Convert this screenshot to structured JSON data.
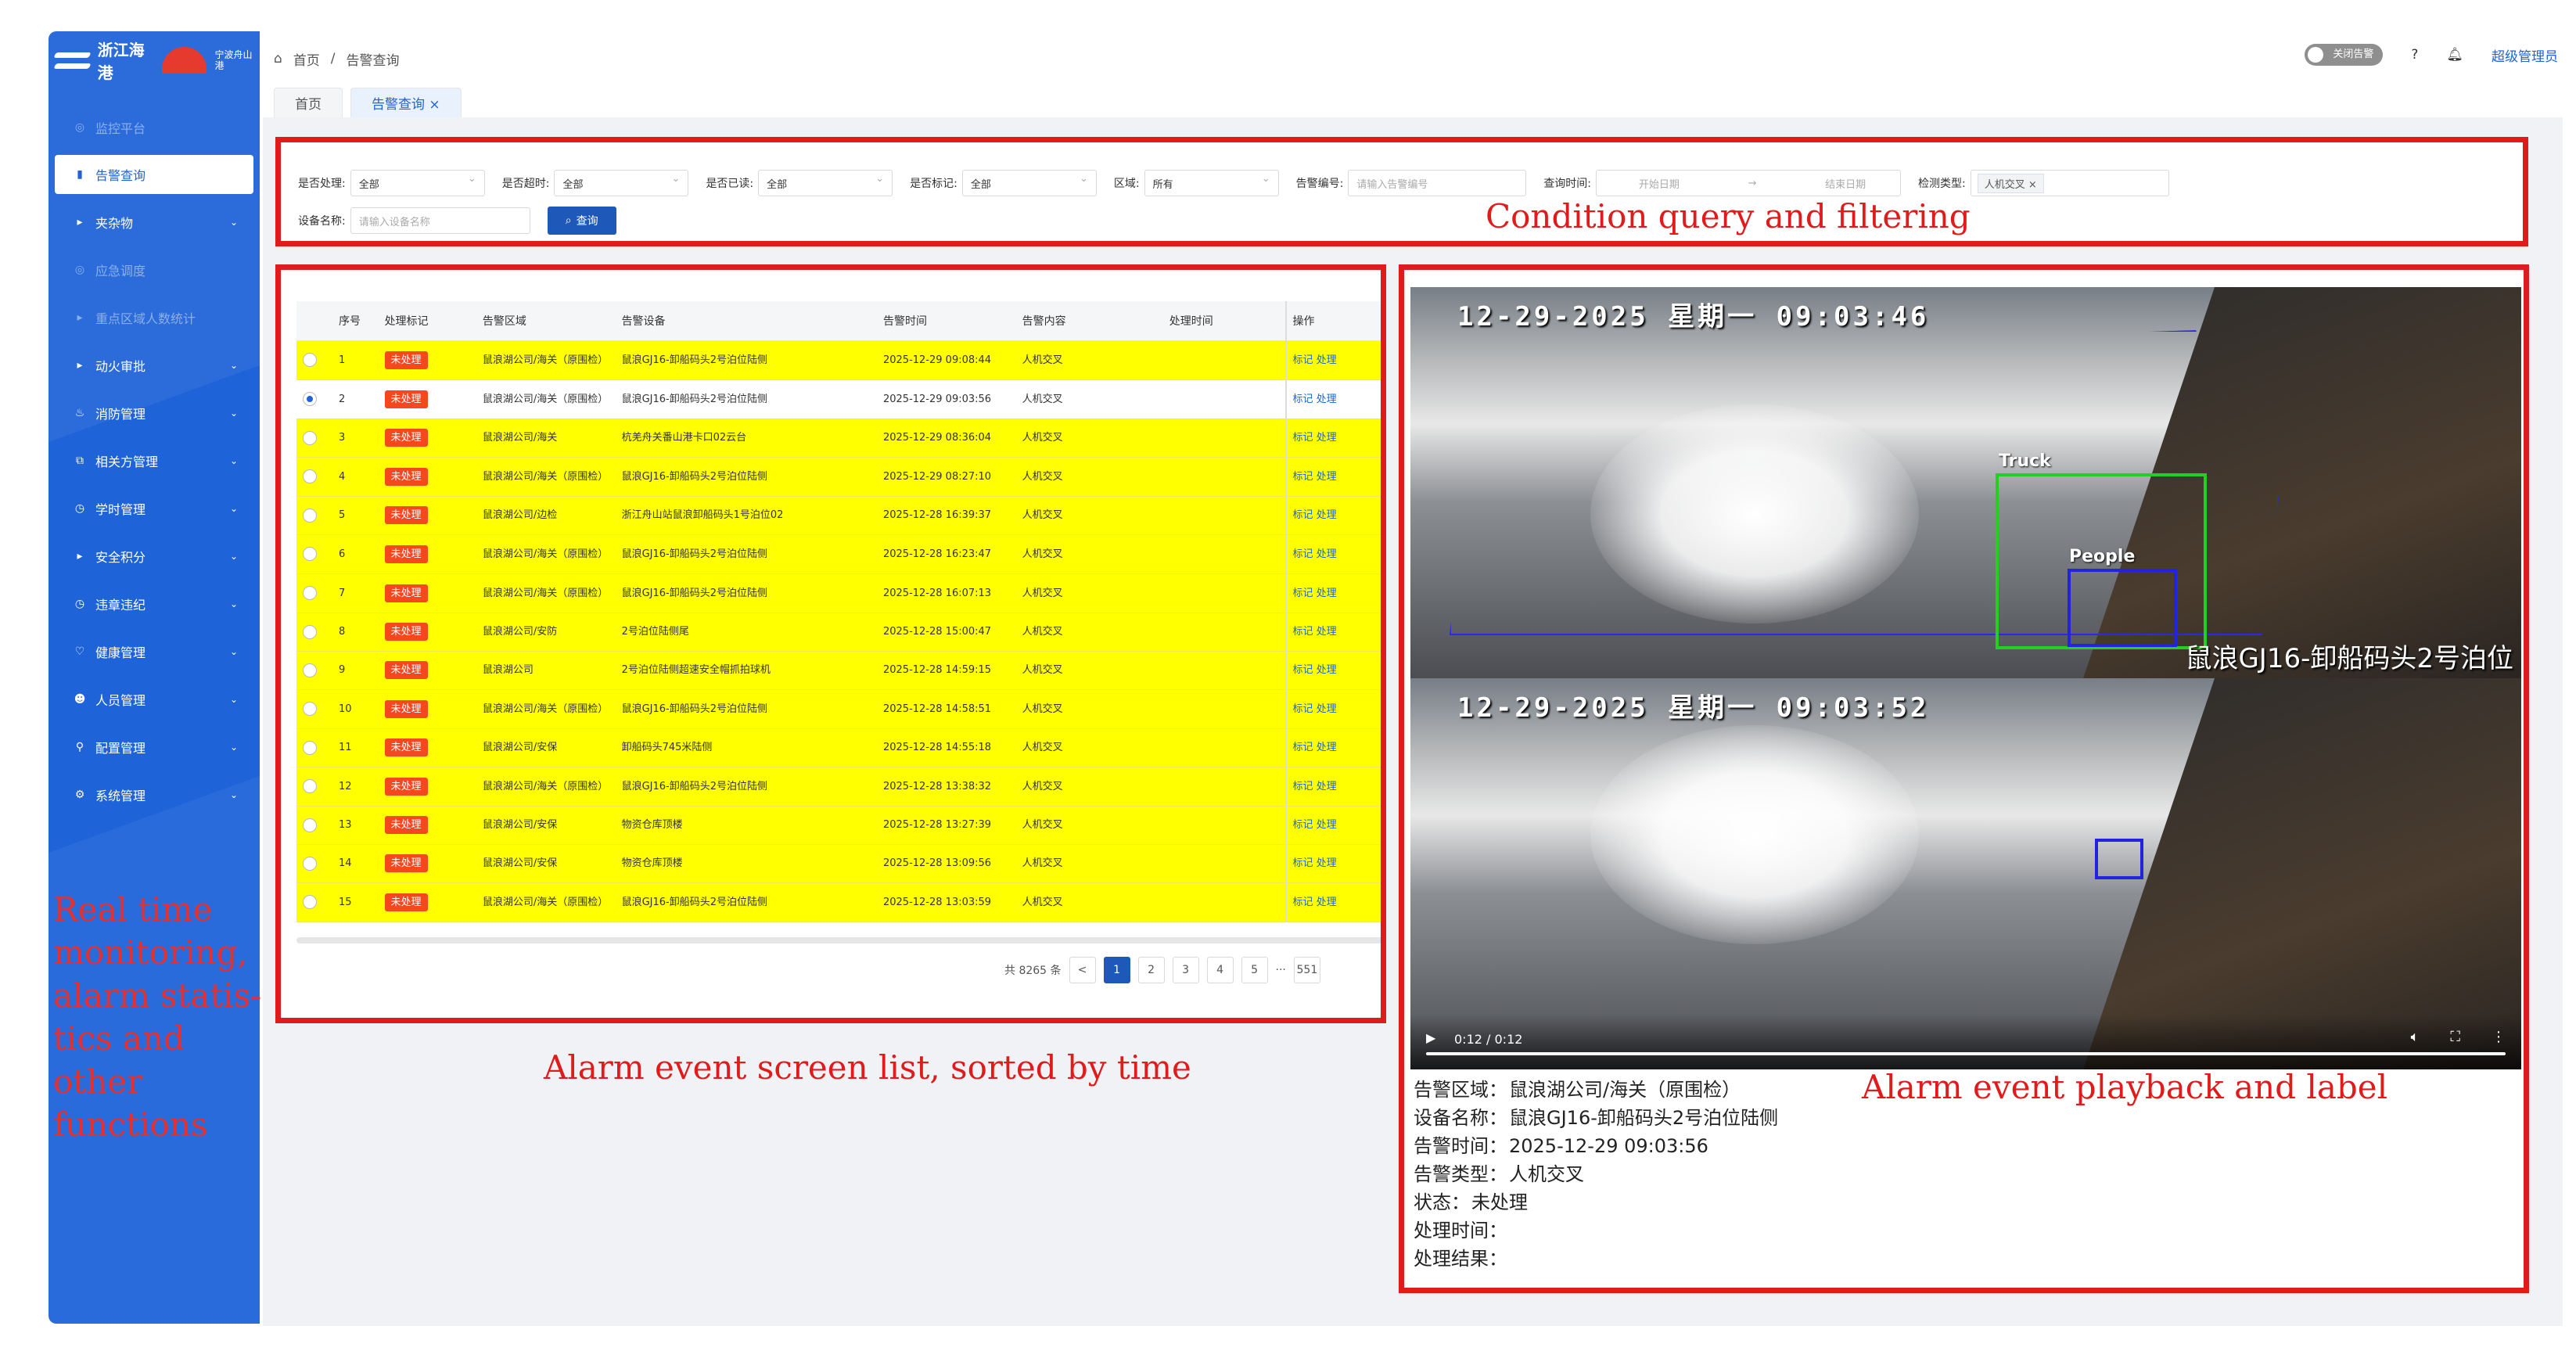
{
  "logo": {
    "name": "浙江海港",
    "sub": "宁波舟山港"
  },
  "sidebar": {
    "items": [
      {
        "label": "监控平台",
        "icon": "monitor-icon",
        "state": "dim"
      },
      {
        "label": "告警查询",
        "icon": "chart-icon",
        "state": "active"
      },
      {
        "label": "夹杂物",
        "icon": "play-icon",
        "chevron": true
      },
      {
        "label": "应急调度",
        "icon": "monitor-icon",
        "state": "dim"
      },
      {
        "label": "重点区域人数统计",
        "icon": "play-icon",
        "state": "dim"
      },
      {
        "label": "动火审批",
        "icon": "play-icon",
        "chevron": true
      },
      {
        "label": "消防管理",
        "icon": "fire-icon",
        "chevron": true
      },
      {
        "label": "相关方管理",
        "icon": "org-icon",
        "chevron": true
      },
      {
        "label": "学时管理",
        "icon": "clock-icon",
        "chevron": true
      },
      {
        "label": "安全积分",
        "icon": "play-icon",
        "chevron": true
      },
      {
        "label": "违章违纪",
        "icon": "clock-icon",
        "chevron": true
      },
      {
        "label": "健康管理",
        "icon": "heart-icon",
        "chevron": true
      },
      {
        "label": "人员管理",
        "icon": "user-icon",
        "chevron": true
      },
      {
        "label": "配置管理",
        "icon": "link-icon",
        "chevron": true
      },
      {
        "label": "系统管理",
        "icon": "gear-icon",
        "chevron": true
      }
    ]
  },
  "annotations": {
    "sidebar": "Real time monitoring, alarm statis-tics and other functions",
    "filter": "Condition query and filtering",
    "list": "Alarm event screen list, sorted by time",
    "playback": "Alarm event playback and label"
  },
  "topbar": {
    "home": "首页",
    "current": "告警查询",
    "toggle": "关闭告警",
    "admin": "超级管理员"
  },
  "tabs": [
    {
      "label": "首页"
    },
    {
      "label": "告警查询"
    }
  ],
  "filters": {
    "handled": {
      "label": "是否处理:",
      "value": "全部"
    },
    "timeout": {
      "label": "是否超时:",
      "value": "全部"
    },
    "read": {
      "label": "是否已读:",
      "value": "全部"
    },
    "marked": {
      "label": "是否标记:",
      "value": "全部"
    },
    "area": {
      "label": "区域:",
      "value": "所有"
    },
    "code": {
      "label": "告警编号:",
      "placeholder": "请输入告警编号"
    },
    "time": {
      "label": "查询时间:",
      "start": "开始日期",
      "end": "结束日期"
    },
    "type": {
      "label": "检测类型:",
      "tag": "人机交叉"
    },
    "device": {
      "label": "设备名称:",
      "placeholder": "请输入设备名称"
    },
    "query": "查询"
  },
  "table": {
    "headers": [
      "序号",
      "处理标记",
      "告警区域",
      "告警设备",
      "告警时间",
      "告警内容",
      "处理时间",
      "操作"
    ],
    "rows": [
      {
        "no": "1",
        "status": "未处理",
        "area": "鼠浪湖公司/海关（原围检）",
        "device": "鼠浪GJ16-卸船码头2号泊位陆侧",
        "time": "2025-12-29 09:08:44",
        "content": "人机交叉",
        "handled": "",
        "ops": "标记 处理",
        "hl": true
      },
      {
        "no": "2",
        "status": "未处理",
        "area": "鼠浪湖公司/海关（原围检）",
        "device": "鼠浪GJ16-卸船码头2号泊位陆侧",
        "time": "2025-12-29 09:03:56",
        "content": "人机交叉",
        "handled": "",
        "ops": "标记 处理",
        "hl": false,
        "selected": true
      },
      {
        "no": "3",
        "status": "未处理",
        "area": "鼠浪湖公司/海关",
        "device": "杭羌舟关番山港卡口02云台",
        "time": "2025-12-29 08:36:04",
        "content": "人机交叉",
        "handled": "",
        "ops": "标记 处理",
        "hl": true
      },
      {
        "no": "4",
        "status": "未处理",
        "area": "鼠浪湖公司/海关（原围检）",
        "device": "鼠浪GJ16-卸船码头2号泊位陆侧",
        "time": "2025-12-29 08:27:10",
        "content": "人机交叉",
        "handled": "",
        "ops": "标记 处理",
        "hl": true
      },
      {
        "no": "5",
        "status": "未处理",
        "area": "鼠浪湖公司/边检",
        "device": "浙江舟山站鼠浪卸船码头1号泊位02",
        "time": "2025-12-28 16:39:37",
        "content": "人机交叉",
        "handled": "",
        "ops": "标记 处理",
        "hl": true
      },
      {
        "no": "6",
        "status": "未处理",
        "area": "鼠浪湖公司/海关（原围检）",
        "device": "鼠浪GJ16-卸船码头2号泊位陆侧",
        "time": "2025-12-28 16:23:47",
        "content": "人机交叉",
        "handled": "",
        "ops": "标记 处理",
        "hl": true
      },
      {
        "no": "7",
        "status": "未处理",
        "area": "鼠浪湖公司/海关（原围检）",
        "device": "鼠浪GJ16-卸船码头2号泊位陆侧",
        "time": "2025-12-28 16:07:13",
        "content": "人机交叉",
        "handled": "",
        "ops": "标记 处理",
        "hl": true
      },
      {
        "no": "8",
        "status": "未处理",
        "area": "鼠浪湖公司/安防",
        "device": "2号泊位陆侧尾",
        "time": "2025-12-28 15:00:47",
        "content": "人机交叉",
        "handled": "",
        "ops": "标记 处理",
        "hl": true
      },
      {
        "no": "9",
        "status": "未处理",
        "area": "鼠浪湖公司",
        "device": "2号泊位陆侧超速安全帽抓拍球机",
        "time": "2025-12-28 14:59:15",
        "content": "人机交叉",
        "handled": "",
        "ops": "标记 处理",
        "hl": true
      },
      {
        "no": "10",
        "status": "未处理",
        "area": "鼠浪湖公司/海关（原围检）",
        "device": "鼠浪GJ16-卸船码头2号泊位陆侧",
        "time": "2025-12-28 14:58:51",
        "content": "人机交叉",
        "handled": "",
        "ops": "标记 处理",
        "hl": true
      },
      {
        "no": "11",
        "status": "未处理",
        "area": "鼠浪湖公司/安保",
        "device": "卸船码头745米陆侧",
        "time": "2025-12-28 14:55:18",
        "content": "人机交叉",
        "handled": "",
        "ops": "标记 处理",
        "hl": true
      },
      {
        "no": "12",
        "status": "未处理",
        "area": "鼠浪湖公司/海关（原围检）",
        "device": "鼠浪GJ16-卸船码头2号泊位陆侧",
        "time": "2025-12-28 13:38:32",
        "content": "人机交叉",
        "handled": "",
        "ops": "标记 处理",
        "hl": true
      },
      {
        "no": "13",
        "status": "未处理",
        "area": "鼠浪湖公司/安保",
        "device": "物资仓库顶楼",
        "time": "2025-12-28 13:27:39",
        "content": "人机交叉",
        "handled": "",
        "ops": "标记 处理",
        "hl": true
      },
      {
        "no": "14",
        "status": "未处理",
        "area": "鼠浪湖公司/安保",
        "device": "物资仓库顶楼",
        "time": "2025-12-28 13:09:56",
        "content": "人机交叉",
        "handled": "",
        "ops": "标记 处理",
        "hl": true
      },
      {
        "no": "15",
        "status": "未处理",
        "area": "鼠浪湖公司/海关（原围检）",
        "device": "鼠浪GJ16-卸船码头2号泊位陆侧",
        "time": "2025-12-28 13:03:59",
        "content": "人机交叉",
        "handled": "",
        "ops": "标记 处理",
        "hl": true
      }
    ]
  },
  "pager": {
    "total": "共 8265 条",
    "prev": "<",
    "pages": [
      "1",
      "2",
      "3",
      "4",
      "5"
    ],
    "ellipsis": "···",
    "last": "551",
    "current": "1"
  },
  "video": {
    "frame1": {
      "timestamp": "12-29-2025  星期一  09:03:46",
      "camera": "鼠浪GJ16-卸船码头2号泊位",
      "labels": [
        "Truck",
        "People"
      ]
    },
    "frame2": {
      "timestamp": "12-29-2025  星期一  09:03:52"
    },
    "time": "0:12 / 0:12",
    "progress": 1.0
  },
  "info": [
    {
      "label": "告警区域：",
      "value": "鼠浪湖公司/海关（原围检）"
    },
    {
      "label": "设备名称：",
      "value": "鼠浪GJ16-卸船码头2号泊位陆侧"
    },
    {
      "label": "告警时间：",
      "value": "2025-12-29 09:03:56"
    },
    {
      "label": "告警类型：",
      "value": "人机交叉"
    },
    {
      "label": "状态：",
      "value": "未处理"
    },
    {
      "label": "处理时间：",
      "value": ""
    },
    {
      "label": "处理结果：",
      "value": ""
    }
  ],
  "colors": {
    "brand": "#1e63d8",
    "highlight": "#ffff00",
    "badge": "#f5481e",
    "annotation": "#e01b1b"
  }
}
